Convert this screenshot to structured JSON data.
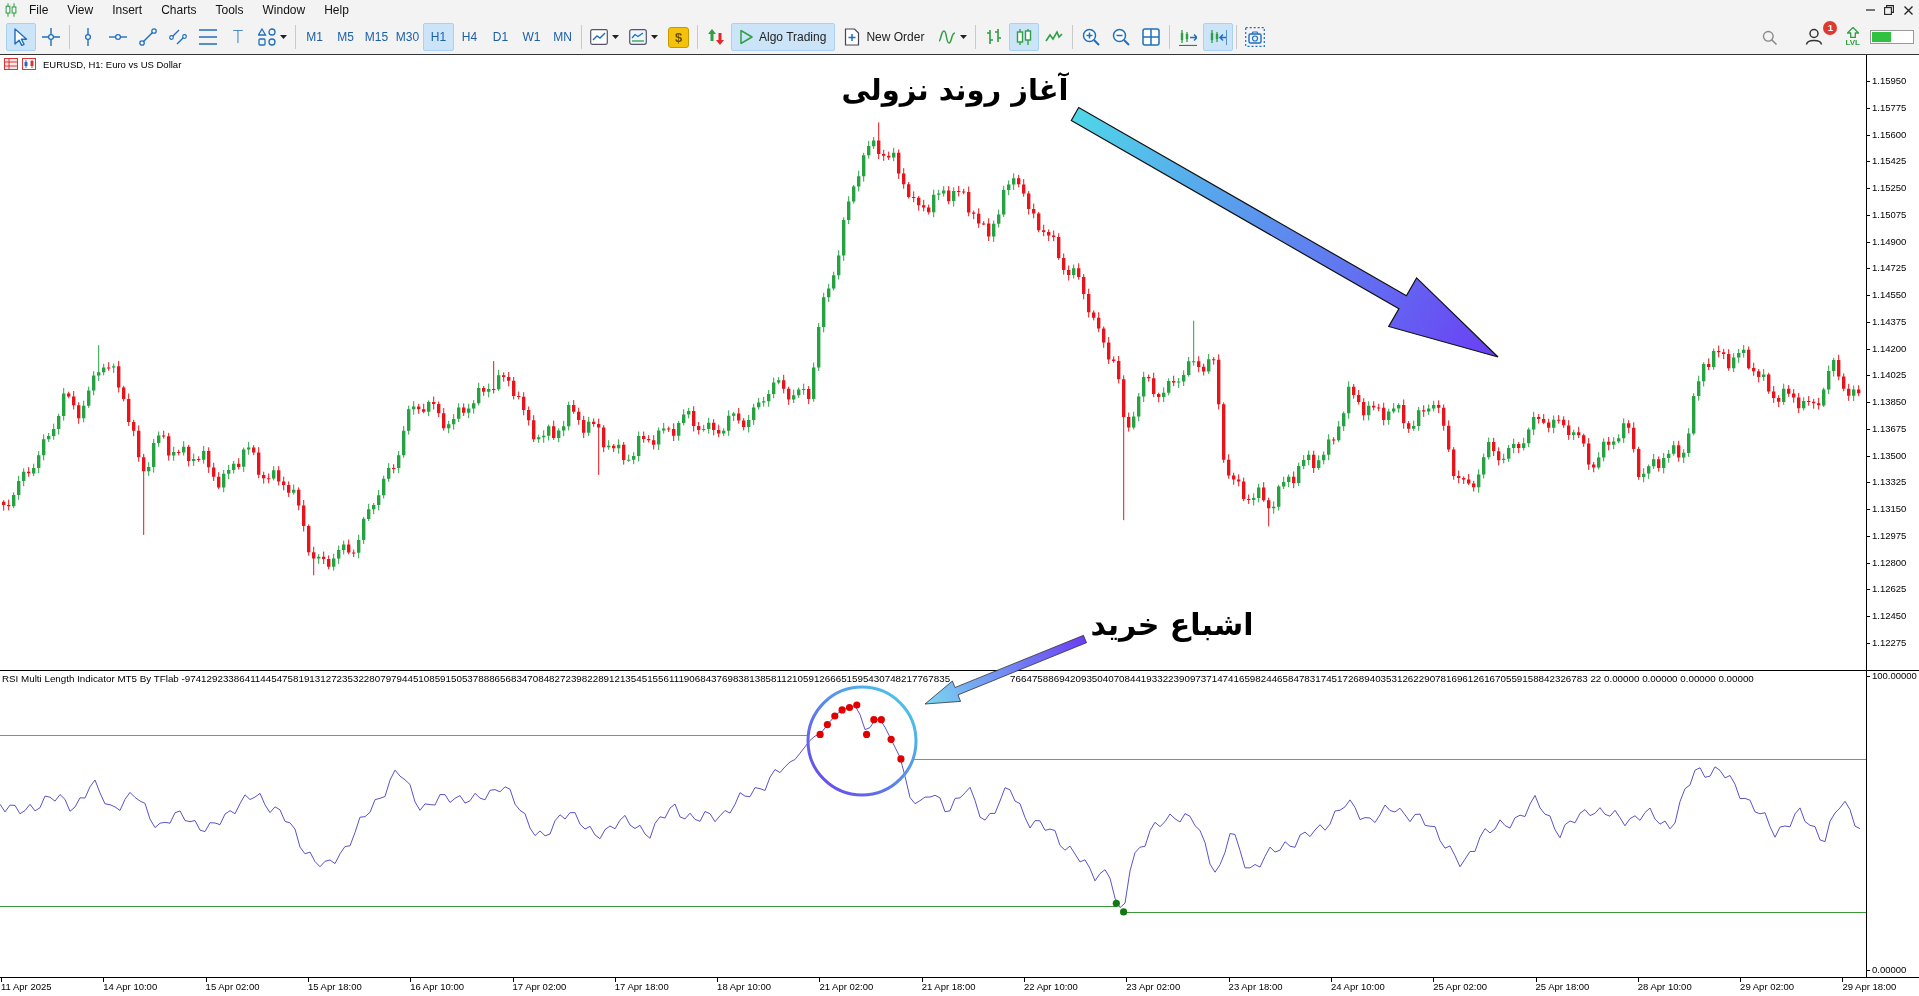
{
  "menu_bar": {
    "items": [
      "File",
      "View",
      "Insert",
      "Charts",
      "Tools",
      "Window",
      "Help"
    ]
  },
  "toolbar": {
    "drawing_tools": [
      {
        "kind": "icon",
        "selected": true
      },
      {
        "kind": "icon",
        "selected": false
      },
      {
        "kind": "icon",
        "selected": false
      },
      {
        "kind": "icon",
        "selected": false
      },
      {
        "kind": "icon",
        "selected": false
      },
      {
        "kind": "icon",
        "selected": false
      },
      {
        "kind": "icon",
        "selected": false
      },
      {
        "kind": "text",
        "label": "T",
        "selected": false
      },
      {
        "kind": "icon",
        "selected": false
      }
    ],
    "timeframes": [
      {
        "label": "M1",
        "selected": false
      },
      {
        "label": "M5",
        "selected": false
      },
      {
        "label": "M15",
        "selected": false
      },
      {
        "label": "M30",
        "selected": false
      },
      {
        "label": "H1",
        "selected": true
      },
      {
        "label": "H4",
        "selected": false
      },
      {
        "label": "D1",
        "selected": false
      },
      {
        "label": "W1",
        "selected": false
      },
      {
        "label": "MN",
        "selected": false
      }
    ],
    "market_button": {
      "label": "$"
    },
    "algo_trading": {
      "label": "Algo Trading",
      "on": true
    },
    "new_order": {
      "label": "New Order"
    },
    "chart_types": [
      {
        "selected": false
      },
      {
        "selected": true
      },
      {
        "selected": false
      }
    ],
    "chart_shift": [
      {
        "on": false
      },
      {
        "on": true
      }
    ]
  },
  "account": {
    "badge": "1",
    "level_label": "LVL"
  },
  "chart": {
    "title": "EURUSD, H1: Euro vs US Dollar",
    "price_axis": [
      "1.15950",
      "1.15775",
      "1.15600",
      "1.15425",
      "1.15250",
      "1.15075",
      "1.14900",
      "1.14725",
      "1.14550",
      "1.14375",
      "1.14200",
      "1.14025",
      "1.13850",
      "1.13675",
      "1.13500",
      "1.13325",
      "1.13150",
      "1.12975",
      "1.12800",
      "1.12625",
      "1.12450",
      "1.12275"
    ],
    "annotations": [
      {
        "text": "آغاز روند نزولی"
      },
      {
        "text": "اشباع خرید"
      }
    ]
  },
  "indicator": {
    "header_parts": [
      "RSI Multi Length Indicator MT5 By TFlab -974129233864114454758191312723532280797944510859150537888656834708482723982289121354515561119068437698381385811210591266651595430748217767835",
      "7664758869420935040708441933223909737147416598244658478317451726894035312622907816961261670559158842326783 22 0.00000 0.00000 0.00000 0.00000"
    ],
    "axis": [
      "100.00000",
      "0.00000"
    ]
  },
  "time_axis": [
    "11 Apr 2025",
    "14 Apr 10:00",
    "15 Apr 02:00",
    "15 Apr 18:00",
    "16 Apr 10:00",
    "17 Apr 02:00",
    "17 Apr 18:00",
    "18 Apr 10:00",
    "21 Apr 02:00",
    "21 Apr 18:00",
    "22 Apr 10:00",
    "23 Apr 02:00",
    "23 Apr 18:00",
    "24 Apr 10:00",
    "25 Apr 02:00",
    "25 Apr 18:00",
    "28 Apr 10:00",
    "29 Apr 02:00",
    "29 Apr 18:00"
  ]
}
